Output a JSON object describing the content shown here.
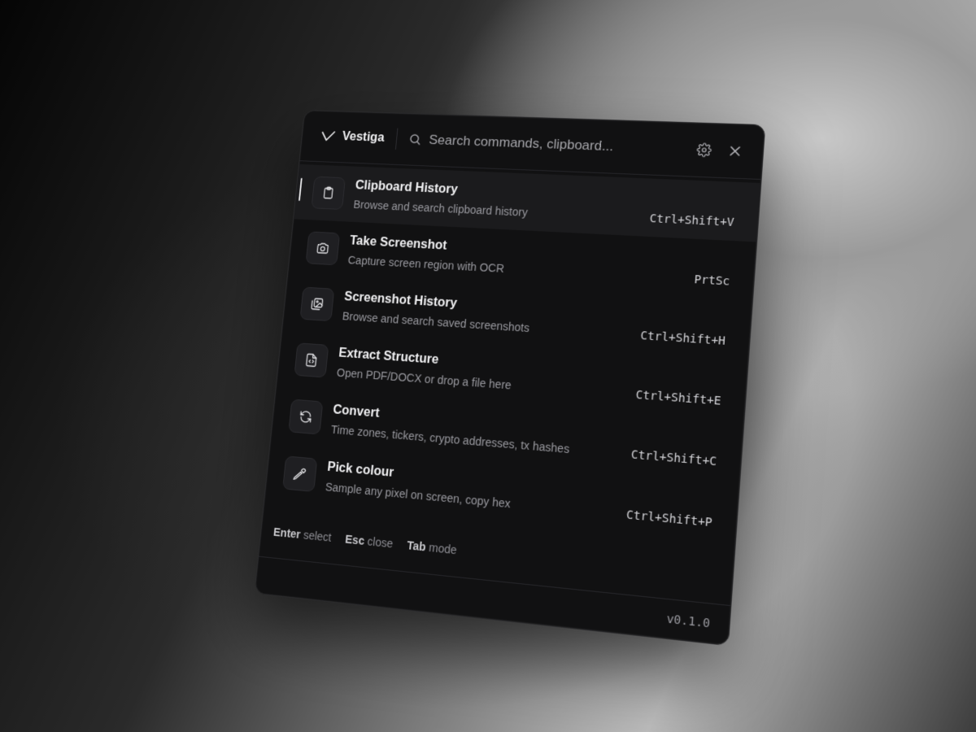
{
  "app": {
    "name": "Vestiga",
    "logo_icon": "v-check-logo"
  },
  "search": {
    "placeholder": "Search commands, clipboard...",
    "value": ""
  },
  "header_buttons": {
    "settings_icon": "gear-icon",
    "close_icon": "close-icon"
  },
  "commands": [
    {
      "title": "Clipboard History",
      "description": "Browse and search clipboard history",
      "shortcut": "Ctrl+Shift+V",
      "icon": "clipboard-icon",
      "active": true
    },
    {
      "title": "Take Screenshot",
      "description": "Capture screen region with OCR",
      "shortcut": "PrtSc",
      "icon": "camera-icon"
    },
    {
      "title": "Screenshot History",
      "description": "Browse and search saved screenshots",
      "shortcut": "Ctrl+Shift+H",
      "icon": "images-icon"
    },
    {
      "title": "Extract Structure",
      "description": "Open PDF/DOCX or drop a file here",
      "shortcut": "Ctrl+Shift+E",
      "icon": "file-code-icon"
    },
    {
      "title": "Convert",
      "description": "Time zones, tickers, crypto addresses, tx hashes",
      "shortcut": "Ctrl+Shift+C",
      "icon": "refresh-icon"
    },
    {
      "title": "Pick colour",
      "description": "Sample any pixel on screen, copy hex",
      "shortcut": "Ctrl+Shift+P",
      "icon": "eyedropper-icon"
    }
  ],
  "footer": {
    "hints": [
      {
        "key": "Enter",
        "label": "select"
      },
      {
        "key": "Esc",
        "label": "close"
      },
      {
        "key": "Tab",
        "label": "mode"
      }
    ],
    "version": "v0.1.0"
  },
  "colors": {
    "panel": "#111112",
    "active_row": "#1b1b1d",
    "text": "#f2f2f4",
    "muted": "#9a9aa0"
  }
}
